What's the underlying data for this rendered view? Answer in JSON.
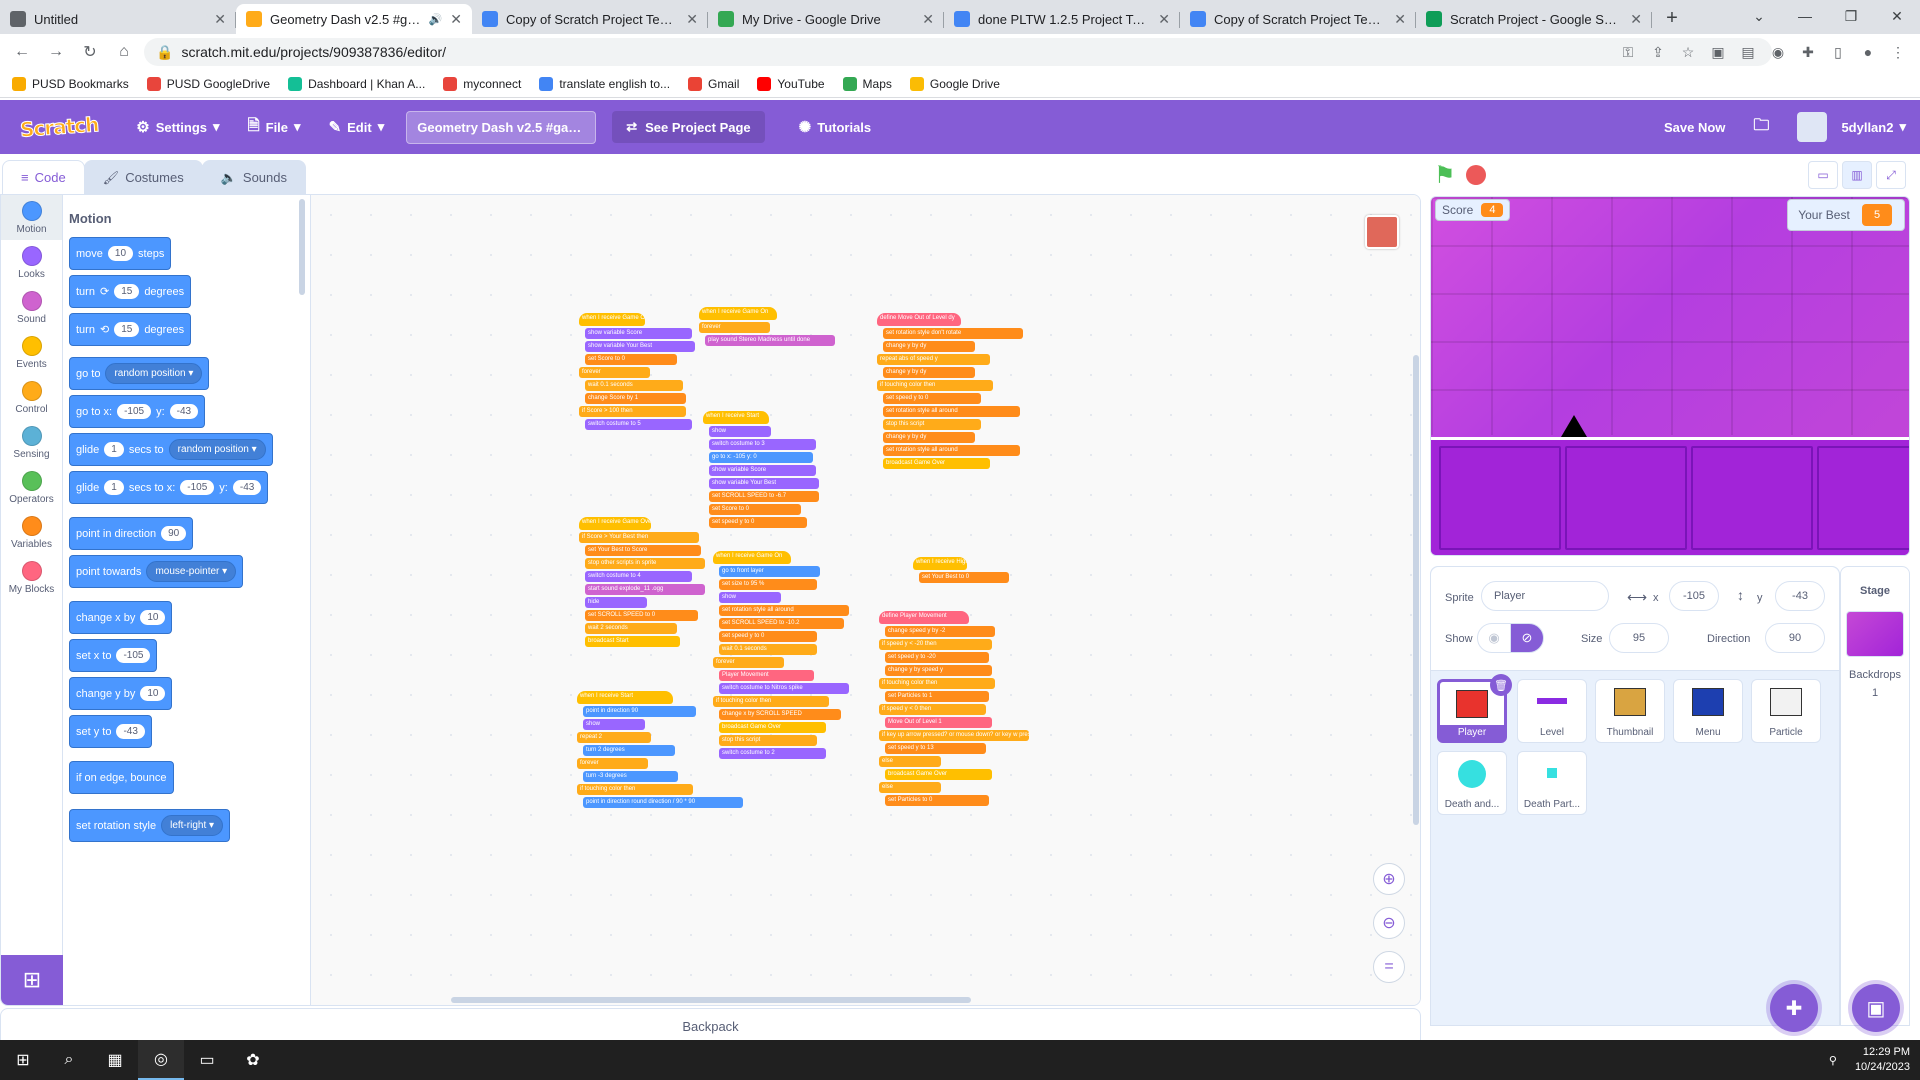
{
  "browser": {
    "tabs": [
      {
        "title": "Untitled",
        "color": "#5f6368"
      },
      {
        "title": "Geometry Dash v2.5 #game",
        "color": "#ffab19",
        "active": true
      },
      {
        "title": "Copy of Scratch Project Templat",
        "color": "#4285f4"
      },
      {
        "title": "My Drive - Google Drive",
        "color": "#34a853"
      },
      {
        "title": "done PLTW 1.2.5 Project Templ",
        "color": "#4285f4"
      },
      {
        "title": "Copy of Scratch Project Templat",
        "color": "#4285f4"
      },
      {
        "title": "Scratch Project - Google Sheets",
        "color": "#0f9d58"
      }
    ],
    "url": "scratch.mit.edu/projects/909387836/editor/",
    "bookmarks": [
      {
        "label": "PUSD Bookmarks",
        "color": "#f9ab00"
      },
      {
        "label": "PUSD GoogleDrive",
        "color": "#e8453c"
      },
      {
        "label": "Dashboard | Khan A...",
        "color": "#14bf96"
      },
      {
        "label": "myconnect",
        "color": "#e8453c"
      },
      {
        "label": "translate english to...",
        "color": "#4285f4"
      },
      {
        "label": "Gmail",
        "color": "#ea4335"
      },
      {
        "label": "YouTube",
        "color": "#ff0000"
      },
      {
        "label": "Maps",
        "color": "#34a853"
      },
      {
        "label": "Google Drive",
        "color": "#fbbc04"
      }
    ]
  },
  "menubar": {
    "logo": "Scratch",
    "settings": "Settings",
    "file": "File",
    "edit": "Edit",
    "project_title": "Geometry Dash v2.5 #gam...",
    "see_project": "See Project Page",
    "tutorials": "Tutorials",
    "save_now": "Save Now",
    "username": "5dyllan2"
  },
  "editor_tabs": [
    "Code",
    "Costumes",
    "Sounds"
  ],
  "categories": [
    {
      "label": "Motion",
      "color": "#4c97ff"
    },
    {
      "label": "Looks",
      "color": "#9966ff"
    },
    {
      "label": "Sound",
      "color": "#cf63cf"
    },
    {
      "label": "Events",
      "color": "#ffbf00"
    },
    {
      "label": "Control",
      "color": "#ffab19"
    },
    {
      "label": "Sensing",
      "color": "#5cb1d6"
    },
    {
      "label": "Operators",
      "color": "#59c059"
    },
    {
      "label": "Variables",
      "color": "#ff8c1a"
    },
    {
      "label": "My Blocks",
      "color": "#ff6680"
    }
  ],
  "palette": {
    "heading": "Motion",
    "blocks": [
      {
        "parts": [
          [
            "t",
            "move"
          ],
          [
            "n",
            "10"
          ],
          [
            "t",
            "steps"
          ]
        ]
      },
      {
        "parts": [
          [
            "t",
            "turn"
          ],
          [
            "t",
            "⟳"
          ],
          [
            "n",
            "15"
          ],
          [
            "t",
            "degrees"
          ]
        ]
      },
      {
        "parts": [
          [
            "t",
            "turn"
          ],
          [
            "t",
            "⟲"
          ],
          [
            "n",
            "15"
          ],
          [
            "t",
            "degrees"
          ]
        ]
      },
      {
        "parts": [
          [
            "t",
            "go to"
          ],
          [
            "d",
            "random position ▾"
          ]
        ]
      },
      {
        "parts": [
          [
            "t",
            "go to x:"
          ],
          [
            "n",
            "-105"
          ],
          [
            "t",
            "y:"
          ],
          [
            "n",
            "-43"
          ]
        ]
      },
      {
        "parts": [
          [
            "t",
            "glide"
          ],
          [
            "n",
            "1"
          ],
          [
            "t",
            "secs to"
          ],
          [
            "d",
            "random position ▾"
          ]
        ]
      },
      {
        "parts": [
          [
            "t",
            "glide"
          ],
          [
            "n",
            "1"
          ],
          [
            "t",
            "secs to x:"
          ],
          [
            "n",
            "-105"
          ],
          [
            "t",
            "y:"
          ],
          [
            "n",
            "-43"
          ]
        ]
      },
      {
        "parts": [
          [
            "t",
            "point in direction"
          ],
          [
            "n",
            "90"
          ]
        ]
      },
      {
        "parts": [
          [
            "t",
            "point towards"
          ],
          [
            "d",
            "mouse-pointer ▾"
          ]
        ]
      },
      {
        "parts": [
          [
            "t",
            "change x by"
          ],
          [
            "n",
            "10"
          ]
        ]
      },
      {
        "parts": [
          [
            "t",
            "set x to"
          ],
          [
            "n",
            "-105"
          ]
        ]
      },
      {
        "parts": [
          [
            "t",
            "change y by"
          ],
          [
            "n",
            "10"
          ]
        ]
      },
      {
        "parts": [
          [
            "t",
            "set y to"
          ],
          [
            "n",
            "-43"
          ]
        ]
      },
      {
        "parts": [
          [
            "t",
            "if on edge, bounce"
          ]
        ]
      },
      {
        "parts": [
          [
            "t",
            "set rotation style"
          ],
          [
            "d",
            "left-right ▾"
          ]
        ]
      }
    ]
  },
  "scripts": [
    {
      "hat": "when I receive Game On",
      "color": "#ffbf00",
      "lines": [
        "show variable Score",
        "show variable Your Best",
        "set Score to 0",
        "forever",
        "wait 0.1 seconds",
        "change Score by 1",
        "if Score > 100 then",
        "switch costume to 5"
      ]
    },
    {
      "hat": "when I receive Game On",
      "color": "#ffbf00",
      "lines": [
        "forever",
        "play sound Stereo Madness until done"
      ]
    },
    {
      "hat": "define Move Out of Level dy",
      "color": "#ff6680",
      "lines": [
        "set rotation style don't rotate",
        "change y by dy",
        "repeat abs of speed y",
        "change y by dy",
        "if touching color then",
        "set speed y to 0",
        "set rotation style all around",
        "stop this script",
        "change y by dy",
        "set rotation style all around",
        "broadcast Game Over"
      ]
    },
    {
      "hat": "when I receive Start",
      "color": "#ffbf00",
      "lines": [
        "show",
        "switch costume to 3",
        "go to x: -105 y: 0",
        "show variable Score",
        "show variable Your Best",
        "set SCROLL SPEED to -6.7",
        "set Score to 0",
        "set speed y to 0"
      ]
    },
    {
      "hat": "when I receive Highscore",
      "color": "#ffbf00",
      "lines": [
        "set Your Best to 0"
      ]
    },
    {
      "hat": "when I receive Game Over",
      "color": "#ffbf00",
      "lines": [
        "if Score > Your Best then",
        "set Your Best to Score",
        "stop other scripts in sprite",
        "switch costume to 4",
        "start sound explode_11 .ogg",
        "hide",
        "set SCROLL SPEED to 0",
        "wait 2 seconds",
        "broadcast Start"
      ]
    },
    {
      "hat": "when I receive Game On",
      "color": "#ffbf00",
      "lines": [
        "go to front layer",
        "set size to 95 %",
        "show",
        "set rotation style all around",
        "set SCROLL SPEED to -10.2",
        "set speed y to 0",
        "wait 0.1 seconds",
        "forever",
        "Player Movement",
        "switch costume to Nitros spike",
        "if touching color then",
        "change x by SCROLL SPEED",
        "broadcast Game Over",
        "stop this script",
        "switch costume to 2"
      ]
    },
    {
      "hat": "define Player Movement",
      "color": "#ff6680",
      "lines": [
        "change speed y by -2",
        "if speed y < -20 then",
        "set speed y to -20",
        "change y by speed y",
        "if touching color then",
        "set Particles to 1",
        "if speed y < 0 then",
        "Move Out of Level 1",
        "if key up arrow pressed? or mouse down? or key w pressed? or key space pressed? then",
        "set speed y to 13",
        "else",
        "broadcast Game Over",
        "else",
        "set Particles to 0"
      ]
    },
    {
      "hat": "when I receive Start",
      "color": "#ffbf00",
      "lines": [
        "point in direction 90",
        "show",
        "repeat 2",
        "turn 2 degrees",
        "forever",
        "turn -3 degrees",
        "if touching color then",
        "point in direction round direction / 90 * 90"
      ]
    }
  ],
  "stage": {
    "monitors": {
      "score_label": "Score",
      "score_value": "4",
      "best_label": "Your Best",
      "best_value": "5"
    }
  },
  "sprite_info": {
    "sprite_label": "Sprite",
    "sprite_name": "Player",
    "x_label": "x",
    "x_value": "-105",
    "y_label": "y",
    "y_value": "-43",
    "show_label": "Show",
    "size_label": "Size",
    "size_value": "95",
    "direction_label": "Direction",
    "direction_value": "90"
  },
  "sprites": [
    {
      "name": "Player",
      "selected": true,
      "thumb_color": "#e8332d"
    },
    {
      "name": "Level",
      "thumb_color": "#8a2be2"
    },
    {
      "name": "Thumbnail",
      "thumb_color": "#d9a441"
    },
    {
      "name": "Menu",
      "thumb_color": "#1d3fb0"
    },
    {
      "name": "Particle",
      "thumb_color": "#f2f2f2"
    },
    {
      "name": "Death and...",
      "thumb_color": "#36e0e0"
    },
    {
      "name": "Death Part...",
      "thumb_color": "#36e0e0"
    }
  ],
  "stage_panel": {
    "label": "Stage",
    "backdrops_label": "Backdrops",
    "backdrops_count": "1"
  },
  "backpack_label": "Backpack",
  "taskbar": {
    "time": "12:29 PM",
    "date": "10/24/2023"
  }
}
